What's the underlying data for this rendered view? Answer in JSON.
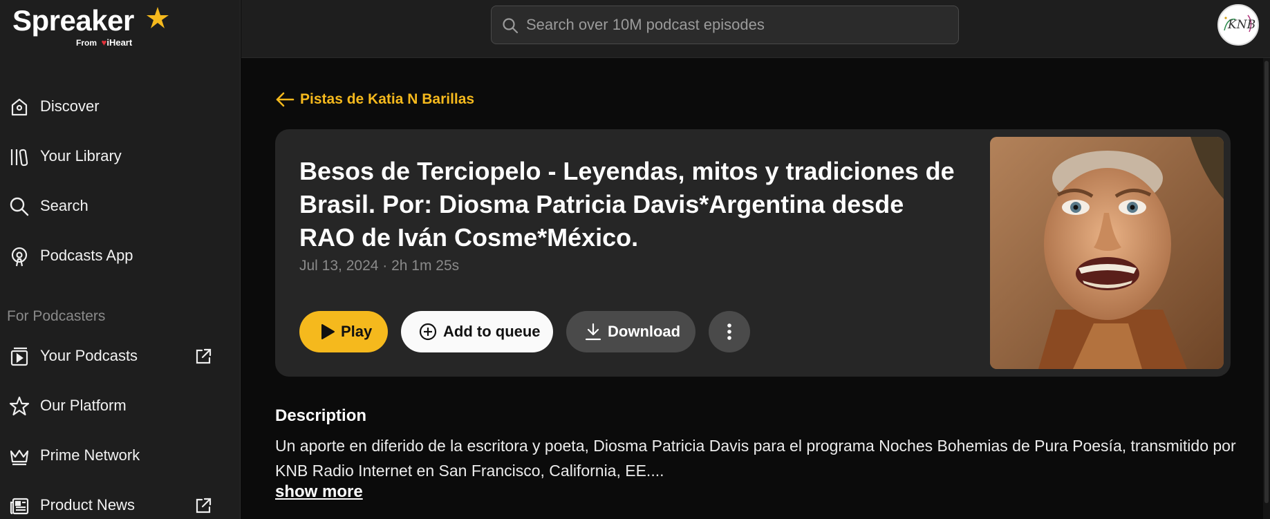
{
  "brand": {
    "name": "Spreaker",
    "sub_from": "From",
    "sub_brand": "iHeart"
  },
  "search": {
    "placeholder": "Search over 10M podcast episodes"
  },
  "sidebar": {
    "items": [
      {
        "label": "Discover",
        "icon": "discover-icon"
      },
      {
        "label": "Your Library",
        "icon": "library-icon"
      },
      {
        "label": "Search",
        "icon": "search-icon"
      },
      {
        "label": "Podcasts App",
        "icon": "podcasts-app-icon"
      }
    ],
    "section_label": "For Podcasters",
    "podcaster_items": [
      {
        "label": "Your Podcasts",
        "icon": "your-podcasts-icon",
        "external": true
      },
      {
        "label": "Our Platform",
        "icon": "star-outline-icon",
        "external": false
      },
      {
        "label": "Prime Network",
        "icon": "crown-icon",
        "external": false
      },
      {
        "label": "Product News",
        "icon": "news-icon",
        "external": true
      }
    ]
  },
  "avatar": {
    "text": "KNB"
  },
  "episode": {
    "back_label": "Pistas de Katia N Barillas",
    "title": "Besos de Terciopelo - Leyendas, mitos y tradiciones de Brasil. Por: Diosma Patricia Davis*Argentina desde RAO de Iván Cosme*México.",
    "meta": "Jul 13, 2024 · 2h 1m 25s",
    "play_label": "Play",
    "queue_label": "Add to queue",
    "download_label": "Download"
  },
  "description": {
    "heading": "Description",
    "text": "Un aporte en diferido de la escritora y poeta, Diosma Patricia Davis para el programa Noches Bohemias de Pura Poesía, transmitido por KNB Radio Internet en San Francisco, California, EE....",
    "show_more": "show more"
  },
  "colors": {
    "accent": "#f5b91d",
    "sidebar_bg": "#1e1e1e",
    "card_bg": "#262626",
    "page_bg": "#0b0b0b"
  }
}
